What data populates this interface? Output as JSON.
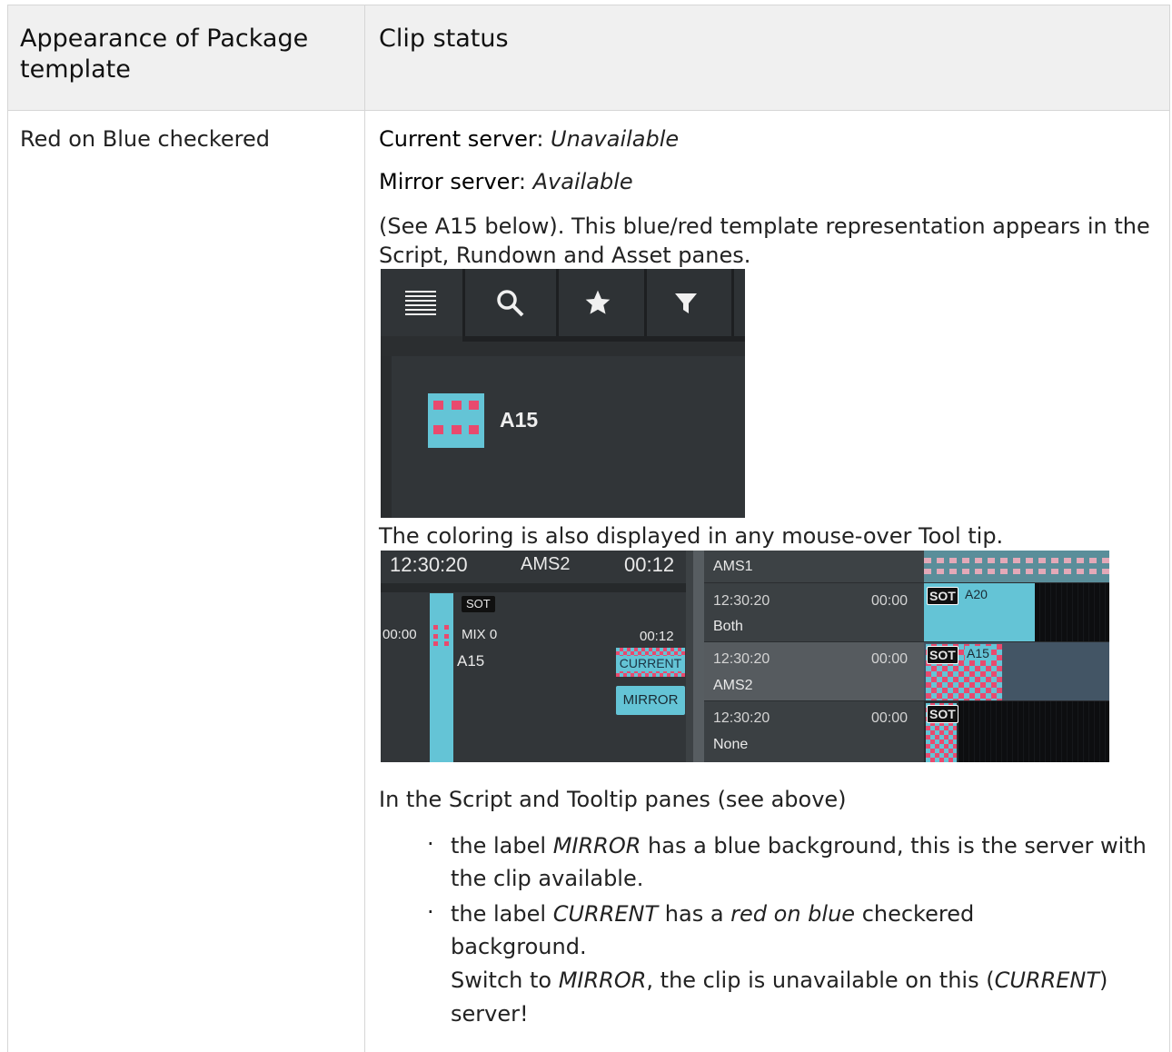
{
  "table": {
    "headers": {
      "col1": "Appearance of Package template",
      "col2": "Clip status"
    },
    "row": {
      "appearance": "Red on Blue checkered",
      "current_server_label": "Current server",
      "current_server_value": "Unavailable",
      "mirror_server_label": "Mirror server",
      "mirror_server_value": "Available",
      "intro_paragraph": "(See A15 below). This blue/red template representation appears in the Script, Rundown and Asset panes.",
      "tooltip_paragraph": "The coloring is also displayed in any mouse-over Tool tip.",
      "panes_paragraph": "In the Script and Tooltip panes (see above)",
      "bullets": [
        {
          "pre": "the label ",
          "em": "MIRROR",
          "post": " has a blue background, this is the server with the clip available."
        },
        {
          "pre": "the label ",
          "em": "CURRENT",
          "mid": " has a ",
          "em2": "red on blue",
          "post": " checkered background."
        }
      ],
      "switch_note": {
        "pre": "Switch to ",
        "em": "MIRROR",
        "mid": ", the clip is unavailable on this (",
        "em2": "CURRENT",
        "post": ") server!"
      }
    }
  },
  "asset_pane": {
    "tabs": [
      "list-icon",
      "search-icon",
      "star-icon",
      "filter-icon"
    ],
    "item_label": "A15",
    "colors": {
      "blue": "#64c4d6",
      "red": "#e84a6e"
    }
  },
  "tooltip_pane": {
    "header": {
      "time": "12:30:20",
      "server": "AMS2",
      "duration": "00:12"
    },
    "story": {
      "badge": "SOT",
      "start": "00:00",
      "mix": "MIX 0",
      "clip": "A15",
      "end": "00:12",
      "current_label": "CURRENT",
      "mirror_label": "MIRROR"
    },
    "rows": [
      {
        "server": "AMS1"
      },
      {
        "time": "12:30:20",
        "duration": "00:00",
        "server": "Both",
        "badge": "SOT",
        "clip": "A20"
      },
      {
        "time": "12:30:20",
        "duration": "00:00",
        "server": "AMS2",
        "badge": "SOT",
        "clip": "A15"
      },
      {
        "time": "12:30:20",
        "duration": "00:00",
        "server": "None",
        "badge": "SOT"
      }
    ]
  }
}
